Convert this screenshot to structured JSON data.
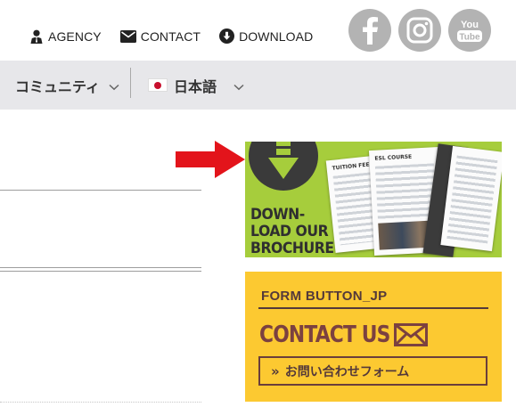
{
  "top_links": [
    {
      "label": "AGENCY",
      "icon": "agent-icon"
    },
    {
      "label": "CONTACT",
      "icon": "envelope-icon"
    },
    {
      "label": "DOWNLOAD",
      "icon": "download-icon"
    }
  ],
  "social": [
    {
      "icon": "facebook-icon"
    },
    {
      "icon": "instagram-icon"
    },
    {
      "icon": "youtube-icon",
      "text_line1": "You",
      "text_line2": "Tube"
    }
  ],
  "nav": {
    "community_label": "コミュニティ",
    "language_label": "日本語",
    "language_flag": "japan-flag-icon"
  },
  "brochure": {
    "line1": "DOWN-",
    "line2": "LOAD OUR",
    "line3": "BROCHURE",
    "doc1_header": "TUITION FEE",
    "doc2_header": "ESL COURSE"
  },
  "contact_box": {
    "title": "FORM BUTTON_JP",
    "headline": "CONTACT US",
    "button_label": "お問い合わせフォーム",
    "button_icon": "»"
  },
  "colors": {
    "nav_bg": "#e7e7ea",
    "brochure_bg": "#a6cd3c",
    "contact_bg": "#fcc931",
    "contact_text": "#54393a",
    "arrow_red": "#e3141b",
    "social_gray": "#b3b3b3"
  }
}
